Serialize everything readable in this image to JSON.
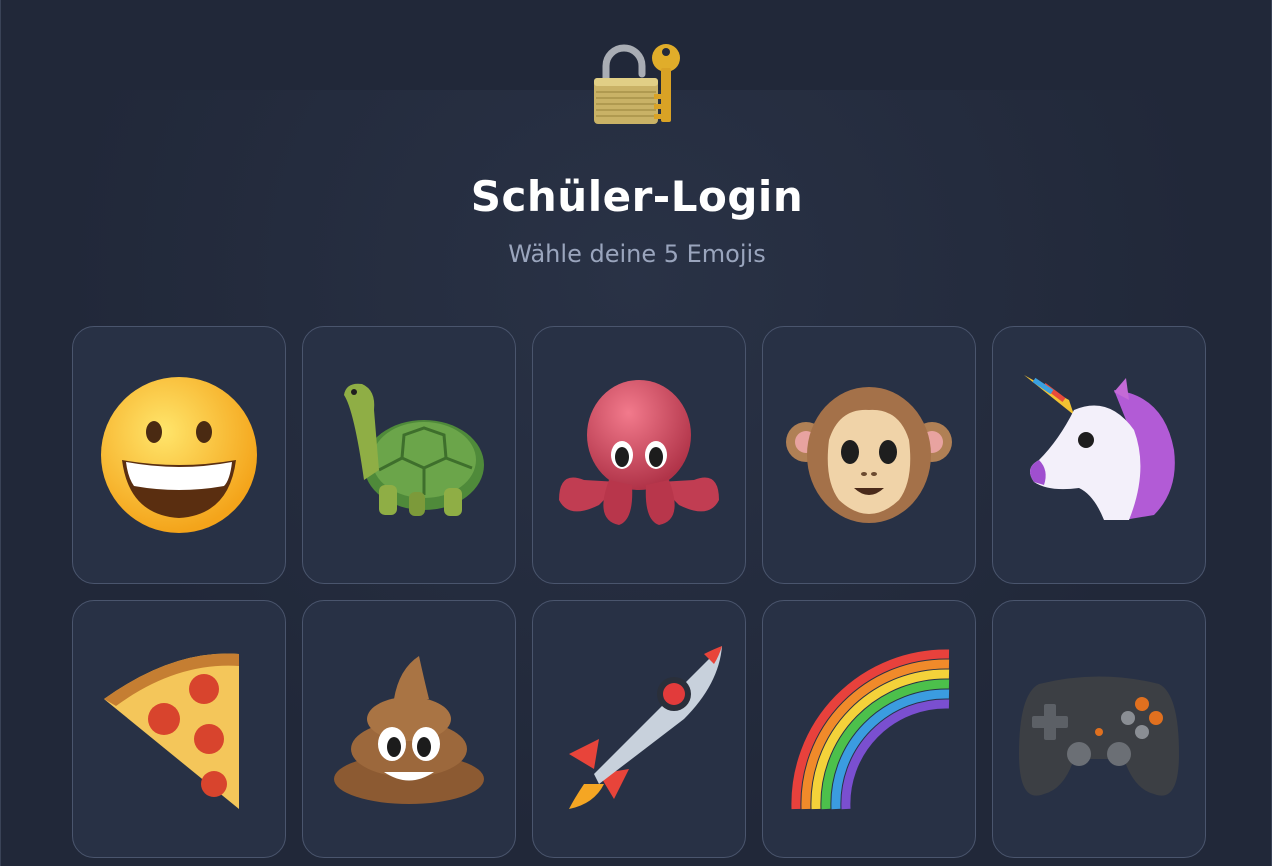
{
  "header": {
    "lock_icon": "lock-with-key-icon",
    "title": "Schüler-Login",
    "subtitle": "Wähle deine 5 Emojis"
  },
  "emojis": [
    {
      "icon": "grinning-face-icon",
      "char": "😀"
    },
    {
      "icon": "turtle-icon",
      "char": "🐢"
    },
    {
      "icon": "octopus-icon",
      "char": "🐙"
    },
    {
      "icon": "monkey-face-icon",
      "char": "🐵"
    },
    {
      "icon": "unicorn-icon",
      "char": "🦄"
    },
    {
      "icon": "pizza-icon",
      "char": "🍕"
    },
    {
      "icon": "pile-of-poo-icon",
      "char": "💩"
    },
    {
      "icon": "rocket-icon",
      "char": "🚀"
    },
    {
      "icon": "rainbow-icon",
      "char": "🌈"
    },
    {
      "icon": "game-controller-icon",
      "char": "🎮"
    }
  ],
  "colors": {
    "background": "#212839",
    "tile": "#283145",
    "tile_border": "#4a556d",
    "title": "#ffffff",
    "subtitle": "#9aa5bd"
  }
}
